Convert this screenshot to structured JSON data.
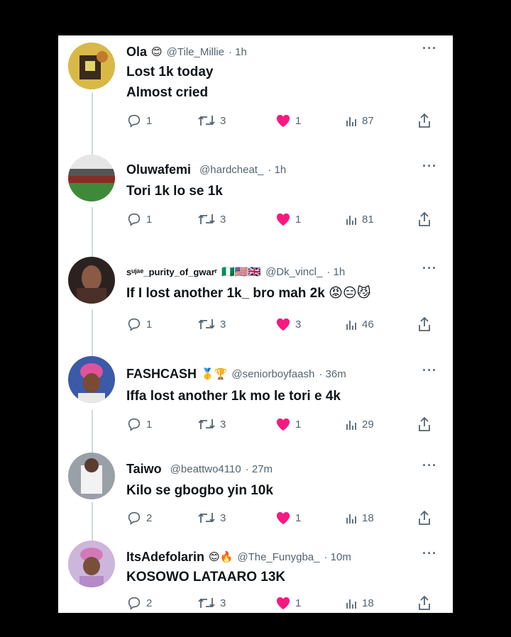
{
  "tweets": [
    {
      "name": "Ola",
      "badges": "😊",
      "handle": "@Tile_Millie",
      "time": "· 1h",
      "lines": [
        "Lost 1k today",
        "Almost cried"
      ],
      "replies": "1",
      "retweets": "3",
      "likes": "1",
      "views": "87",
      "avatar_color": "#c9a646"
    },
    {
      "name": "Oluwafemi",
      "badges": "",
      "handle": "@hardcheat_",
      "time": "· 1h",
      "lines": [
        "Tori 1k lo se 1k"
      ],
      "replies": "1",
      "retweets": "3",
      "likes": "1",
      "views": "81",
      "avatar_color": "#3d7a34"
    },
    {
      "name": "sᵘʲᵃᵉ_purity_of_ɡwarʳ",
      "badges": "🇳🇬🇺🇸🇬🇧",
      "handle": "@Dk_vincl_",
      "time": "· 1h",
      "lines": [
        "If I lost another 1k_ bro mah 2k 😡😑😼"
      ],
      "replies": "1",
      "retweets": "3",
      "likes": "3",
      "views": "46",
      "avatar_color": "#6b4a3a"
    },
    {
      "name": "FASHCASH",
      "badges": "🥇🏆",
      "handle": "@seniorboyfaash",
      "time": "· 36m",
      "lines": [
        "Iffa lost another 1k mo le tori e 4k"
      ],
      "replies": "1",
      "retweets": "3",
      "likes": "1",
      "views": "29",
      "avatar_color": "#e0529c"
    },
    {
      "name": "Taiwo",
      "badges": "",
      "handle": "@beattwo4110",
      "time": "· 27m",
      "lines": [
        "Kilo se gbogbo yin 10k"
      ],
      "replies": "2",
      "retweets": "3",
      "likes": "1",
      "views": "18",
      "avatar_color": "#8a8f98"
    },
    {
      "name": "ItsAdefolarin",
      "badges": "😊🔥",
      "handle": "@The_Funygba_",
      "time": "· 10m",
      "lines": [
        "KOSOWO LATAARO 13K"
      ],
      "replies": "2",
      "retweets": "3",
      "likes": "1",
      "views": "18",
      "avatar_color": "#b48ac8"
    }
  ],
  "colors": {
    "like": "#f91880",
    "muted": "#536471",
    "text": "#0f1419",
    "thread": "#cfd9de"
  },
  "icons": [
    "reply-icon",
    "retweet-icon",
    "heart-icon",
    "views-icon",
    "share-icon",
    "more-icon"
  ]
}
